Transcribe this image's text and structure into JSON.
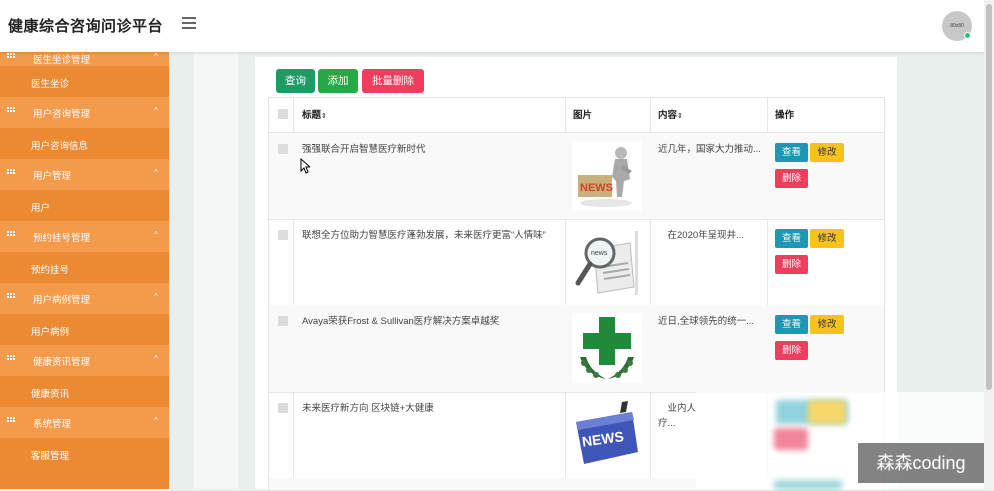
{
  "header": {
    "app_title": "健康综合咨询问诊平台",
    "avatar_text": "80x80"
  },
  "sidebar": {
    "groups": [
      {
        "label": "医生坐诊管理",
        "item": "医生坐诊"
      },
      {
        "label": "用户咨询管理",
        "item": "用户咨询信息"
      },
      {
        "label": "用户管理",
        "item": "用户"
      },
      {
        "label": "预约挂号管理",
        "item": "预约挂号"
      },
      {
        "label": "用户病例管理",
        "item": "用户病例"
      },
      {
        "label": "健康资讯管理",
        "item": "健康资讯"
      },
      {
        "label": "系统管理",
        "item": "客服管理"
      }
    ],
    "caret": "^"
  },
  "toolbar": {
    "query_label": "查询",
    "add_label": "添加",
    "bulk_delete_label": "批量删除"
  },
  "table": {
    "headers": {
      "title": "标题",
      "image": "图片",
      "content": "内容",
      "actions": "操作"
    },
    "sort_icon": "⇕",
    "rows": [
      {
        "title": "强强联合开启智慧医疗新时代",
        "image_icon": "news-figure-icon",
        "content": "近几年，国家大力推动..."
      },
      {
        "title": "联想全方位助力智慧医疗蓬勃发展，未来医疗更富“人情味”",
        "image_icon": "magnifier-newspaper-icon",
        "content": "　在2020年呈现井..."
      },
      {
        "title": "Avaya荣获Frost & Sullivan医疗解决方案卓越奖",
        "image_icon": "green-cross-icon",
        "content": "近日,全球领先的统一..."
      },
      {
        "title": "未来医疗新方向 区块链+大健康",
        "image_icon": "news-key-icon",
        "content": "　业内人\n疗..."
      }
    ],
    "view_label": "查看",
    "edit_label": "修改",
    "delete_label": "删除"
  },
  "watermark": "森森coding",
  "colors": {
    "sidebar_bg": "#ec8a34",
    "sidebar_group_bg": "#f39a4b",
    "query": "#1e9b64",
    "add": "#28a745",
    "danger": "#ef3d5e",
    "view": "#1d97b3",
    "edit": "#f6c21c"
  }
}
